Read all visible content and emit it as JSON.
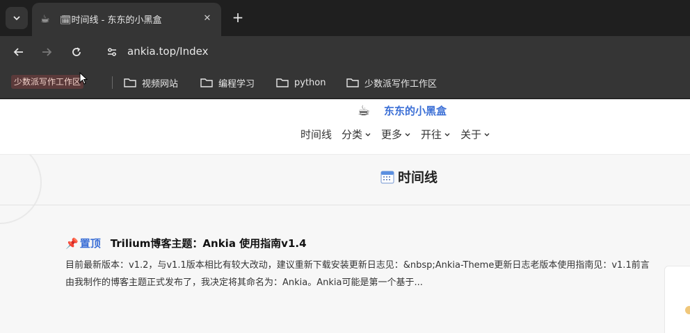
{
  "browser": {
    "tab": {
      "favicon": "calendar-icon",
      "title": "🗓时间线 - 东东的小黑盒",
      "close": "✕"
    },
    "new_tab": "+",
    "url": "ankia.top/Index",
    "bookmarks": [
      {
        "label": "少数派写作工作区",
        "icon": "none",
        "highlighted": true
      },
      {
        "label": "视频网站",
        "icon": "folder-icon"
      },
      {
        "label": "编程学习",
        "icon": "folder-icon"
      },
      {
        "label": "python",
        "icon": "folder-icon"
      },
      {
        "label": "少数派写作工作区",
        "icon": "folder-icon"
      }
    ]
  },
  "site": {
    "logo": "☕",
    "name": "东东的小黑盒",
    "nav": [
      {
        "label": "时间线",
        "has_dropdown": false
      },
      {
        "label": "分类",
        "has_dropdown": true
      },
      {
        "label": "更多",
        "has_dropdown": true
      },
      {
        "label": "开往",
        "has_dropdown": true
      },
      {
        "label": "关于",
        "has_dropdown": true
      }
    ],
    "accent_color": "#3b6fd6"
  },
  "page": {
    "title": "时间线",
    "posts": [
      {
        "pin_icon": "📌",
        "pin_label": "置顶",
        "title": "Trilium博客主题：Ankia 使用指南v1.4",
        "excerpt": "目前最新版本：v1.2，与v1.1版本相比有较大改动，建议重新下载安装更新日志见：&nbsp;Ankia-Theme更新日志老版本使用指南见：v1.1前言由我制作的博客主题正式发布了，我决定将其命名为：Ankia。Ankia可能是第一个基于..."
      }
    ]
  }
}
